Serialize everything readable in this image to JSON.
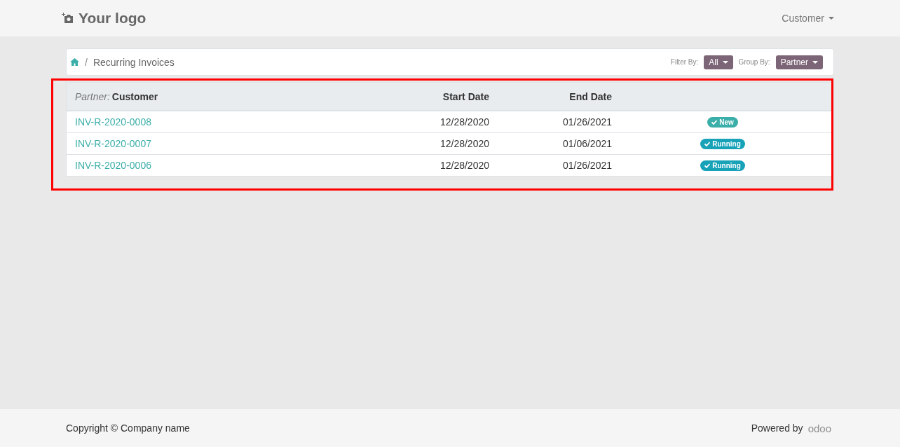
{
  "header": {
    "logo": "Your logo",
    "user_menu": "Customer"
  },
  "breadcrumb": {
    "separator": "/",
    "current": "Recurring Invoices",
    "filter_label": "Filter By:",
    "filter_value": "All",
    "group_label": "Group By:",
    "group_value": "Partner"
  },
  "table": {
    "group_prefix": "Partner:",
    "group_name": "Customer",
    "columns": [
      "Start Date",
      "End Date"
    ],
    "rows": [
      {
        "name": "INV-R-2020-0008",
        "start": "12/28/2020",
        "end": "01/26/2021",
        "status": "New",
        "color": "#3aaea9"
      },
      {
        "name": "INV-R-2020-0007",
        "start": "12/28/2020",
        "end": "01/06/2021",
        "status": "Running",
        "color": "#17a2b8"
      },
      {
        "name": "INV-R-2020-0006",
        "start": "12/28/2020",
        "end": "01/26/2021",
        "status": "Running",
        "color": "#17a2b8"
      }
    ]
  },
  "footer": {
    "copyright": "Copyright © Company name",
    "powered_by": "Powered by",
    "brand": "odoo"
  }
}
